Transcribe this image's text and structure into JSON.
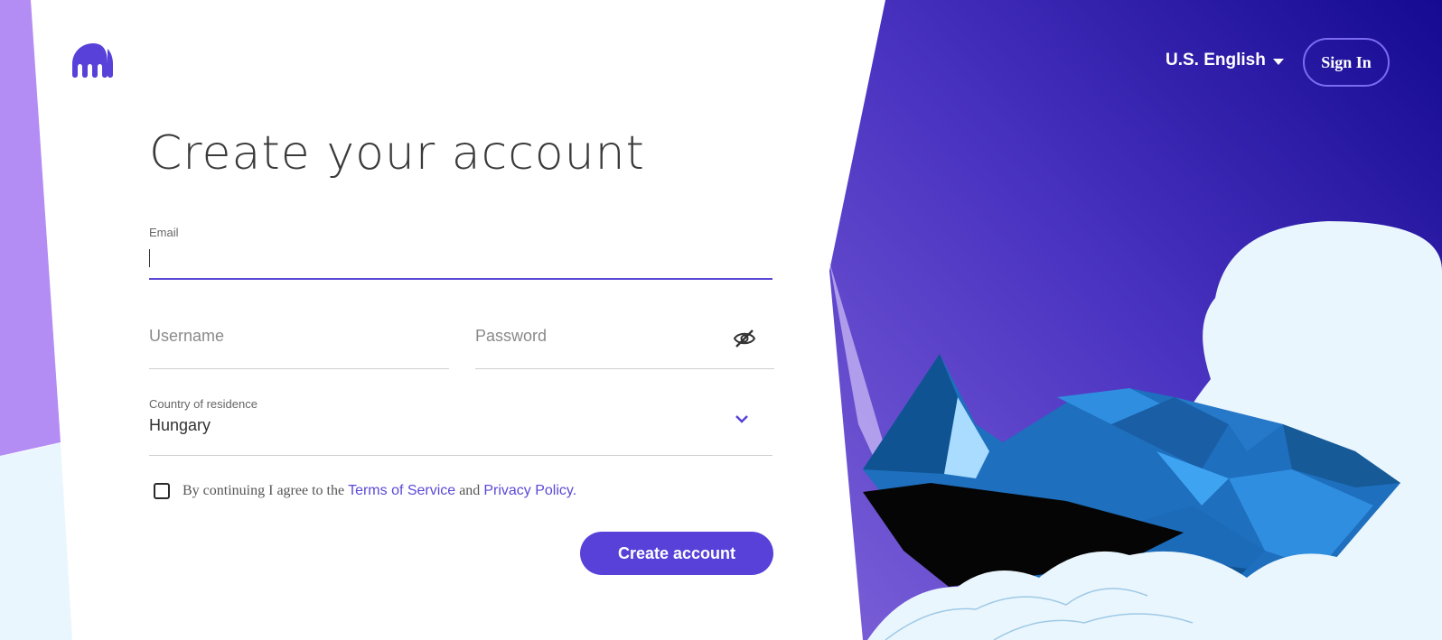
{
  "header": {
    "logo_icon": "kraken-logo-icon",
    "language": "U.S. English",
    "signin_label": "Sign In"
  },
  "form": {
    "title": "Create your account",
    "email_label": "Email",
    "email_value": "",
    "username_placeholder": "Username",
    "password_placeholder": "Password",
    "password_toggle_icon": "eye-slash-icon",
    "country_label": "Country of residence",
    "country_value": "Hungary",
    "terms_prefix": "By continuing I agree to the ",
    "terms_link": "Terms of Service",
    "terms_and": " and ",
    "privacy_link": "Privacy Policy",
    "terms_suffix": ".",
    "create_button": "Create account"
  },
  "colors": {
    "brand": "#5741d9",
    "brand_light": "#b38cf4",
    "panel_dark": "#160b93",
    "cloud": "#eaf6fd"
  }
}
